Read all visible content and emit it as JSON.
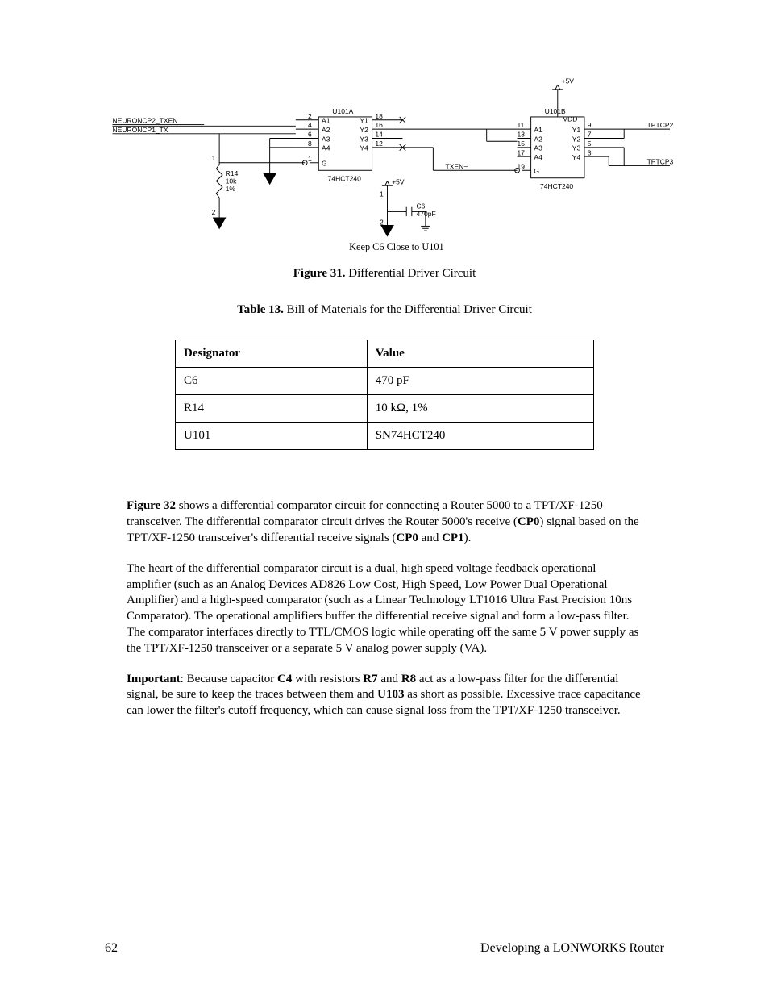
{
  "schematic": {
    "signals_left": [
      "NEURONCP2_TXEN",
      "NEURONCP1_TX"
    ],
    "r14": {
      "ref": "R14",
      "value": "10k",
      "tol": "1%"
    },
    "u101a": {
      "ref": "U101A",
      "type": "74HCT240",
      "left_pins": [
        "2",
        "4",
        "6",
        "8"
      ],
      "left_labels": [
        "A1",
        "A2",
        "A3",
        "A4"
      ],
      "right_labels": [
        "Y1",
        "Y2",
        "Y3",
        "Y4"
      ],
      "right_pins": [
        "18",
        "16",
        "14",
        "12"
      ],
      "g_pin": "1",
      "g_label": "G"
    },
    "u101b": {
      "ref": "U101B",
      "type": "74HCT240",
      "vdd_label": "VDD",
      "rail": "+5V",
      "left_pins": [
        "11",
        "13",
        "15",
        "17",
        "19"
      ],
      "left_labels": [
        "A1",
        "A2",
        "A3",
        "A4",
        "G"
      ],
      "right_labels": [
        "Y1",
        "Y2",
        "Y3",
        "Y4"
      ],
      "right_pins": [
        "9",
        "7",
        "5",
        "3"
      ]
    },
    "txen_net": "TXEN~",
    "c6": {
      "ref": "C6",
      "value": "470pF"
    },
    "c6_rail": "+5V",
    "outputs_right": [
      "TPTCP2",
      "TPTCP3"
    ],
    "note": "Keep C6 Close to U101"
  },
  "figure_caption": {
    "label": "Figure 31.",
    "text": "Differential Driver Circuit"
  },
  "table_caption": {
    "label": "Table 13.",
    "text": "Bill of Materials for the Differential Driver Circuit"
  },
  "bom": {
    "headers": [
      "Designator",
      "Value"
    ],
    "rows": [
      [
        "C6",
        "470 pF"
      ],
      [
        "R14",
        "10 kΩ, 1%"
      ],
      [
        "U101",
        "SN74HCT240"
      ]
    ]
  },
  "para_tokens": {
    "p1": {
      "t1": "Figure 32",
      "t2": " shows a differential comparator circuit for connecting a Router 5000 to a TPT/XF-1250 transceiver.  The differential comparator circuit drives the Router 5000's receive (",
      "t3": "CP0",
      "t4": ") signal based on the TPT/XF-1250 transceiver's differential receive signals (",
      "t5": "CP0",
      "t6": " and ",
      "t7": "CP1",
      "t8": ")."
    },
    "p2": "The heart of the differential comparator circuit is a dual, high speed voltage feedback operational amplifier (such as an Analog Devices AD826 Low Cost, High Speed, Low Power Dual Operational Amplifier) and a high-speed comparator (such as a Linear Technology LT1016 Ultra Fast Precision 10ns Comparator).  The operational amplifiers buffer the differential receive signal and form a low-pass filter.  The comparator interfaces directly to TTL/CMOS logic while operating off the same 5 V power supply as the TPT/XF-1250 transceiver or a separate 5 V analog power supply (VA).",
    "p3": {
      "t1": "Important",
      "t2": ":  Because capacitor ",
      "t3": "C4",
      "t4": " with resistors ",
      "t5": "R7",
      "t6": " and ",
      "t7": "R8",
      "t8": " act as a low-pass filter for the differential signal, be sure to keep the traces between them and ",
      "t9": "U103",
      "t10": " as short as possible.  Excessive trace capacitance can lower the filter's cutoff frequency, which can cause signal loss from the TPT/XF-1250 transceiver."
    }
  },
  "footer": {
    "page": "62",
    "section": "Developing a LONWORKS Router"
  }
}
